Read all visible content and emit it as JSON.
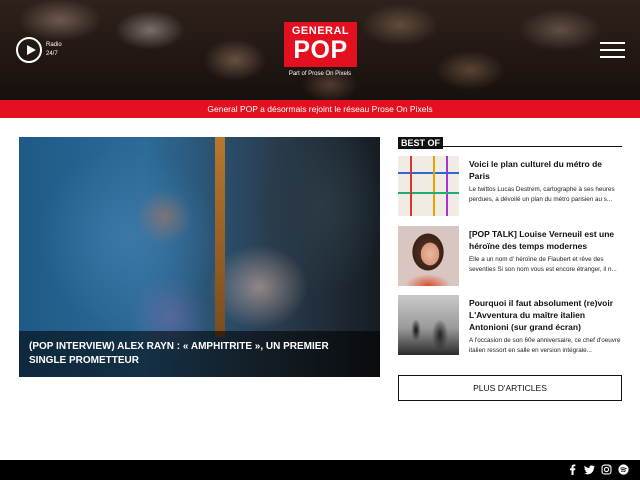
{
  "header": {
    "radio_label_line1": "Radio",
    "radio_label_line2": "24/7",
    "logo_top": "GENERAL",
    "logo_bottom": "POP",
    "logo_tagline": "Part of Prose On Pixels"
  },
  "announcement": "General POP a désormais rejoint le réseau Prose On Pixels",
  "featured": {
    "title": "(POP INTERVIEW) ALEX RAYN : « AMPHITRITE », UN PREMIER SINGLE PROMETTEUR"
  },
  "sidebar": {
    "section_label": "BEST OF",
    "items": [
      {
        "title": "Voici le plan culturel du métro de Paris",
        "excerpt": "Le twittos Lucas Destrem, cartographe à ses heures perdues, a dévoilé un plan du métro parisien au s...",
        "thumb_icon": "metro-map-image"
      },
      {
        "title": "[POP TALK] Louise Verneuil est une héroïne des temps modernes",
        "excerpt": "Elle a un nom d' héroïne de Flaubert et rêve des seventies Si son nom vous est encore étranger, il n...",
        "thumb_icon": "portrait-image"
      },
      {
        "title": "Pourquoi il faut absolument (re)voir L'Avventura du maître italien Antonioni (sur grand écran)",
        "excerpt": "A l'occasion de son 60e anniversaire, ce chef d'oeuvre italien ressort en salle en version intégrale...",
        "thumb_icon": "film-still-image"
      }
    ],
    "more_button": "PLUS D'ARTICLES"
  },
  "footer": {
    "social_icons": [
      "facebook-icon",
      "twitter-icon",
      "instagram-icon",
      "spotify-icon"
    ]
  },
  "colors": {
    "brand_red": "#e4101f",
    "footer_bg": "#000000"
  }
}
